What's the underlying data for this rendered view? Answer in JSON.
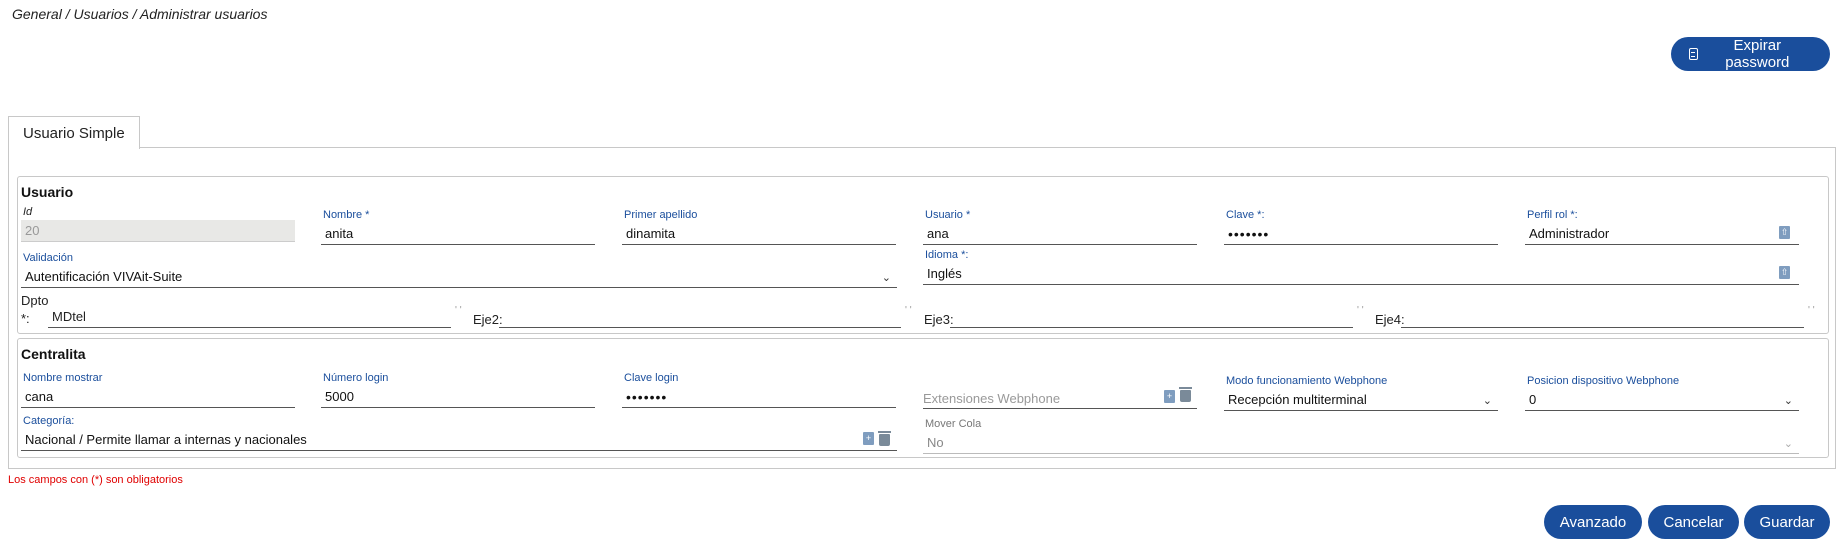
{
  "breadcrumb": "General / Usuarios / Administrar usuarios",
  "buttons": {
    "expire": "Expirar password",
    "advanced": "Avanzado",
    "cancel": "Cancelar",
    "save": "Guardar"
  },
  "tab": "Usuario Simple",
  "usuario": {
    "title": "Usuario",
    "id": {
      "label": "Id",
      "value": "20"
    },
    "nombre": {
      "label": "Nombre *",
      "value": "anita"
    },
    "apellido": {
      "label": "Primer apellido",
      "value": "dinamita"
    },
    "usuario": {
      "label": "Usuario *",
      "value": "ana"
    },
    "clave": {
      "label": "Clave *:",
      "value": "•••••••"
    },
    "perfil": {
      "label": "Perfil rol *:",
      "value": "Administrador"
    },
    "validacion": {
      "label": "Validación",
      "value": "Autentificación VIVAit-Suite"
    },
    "idioma": {
      "label": "Idioma *:",
      "value": "Inglés"
    },
    "dpto": {
      "label_top": "Dpto",
      "label_bottom": "*:",
      "value": "MDtel"
    },
    "eje2": {
      "label": "Eje2:",
      "value": ""
    },
    "eje3": {
      "label": "Eje3:",
      "value": ""
    },
    "eje4": {
      "label": "Eje4:",
      "value": ""
    }
  },
  "centralita": {
    "title": "Centralita",
    "nombre_mostrar": {
      "label": "Nombre mostrar",
      "value": "cana"
    },
    "numero_login": {
      "label": "Número login",
      "value": "5000"
    },
    "clave_login": {
      "label": "Clave login",
      "value": "•••••••"
    },
    "extensiones": {
      "placeholder": "Extensiones Webphone"
    },
    "modo": {
      "label": "Modo funcionamiento Webphone",
      "value": "Recepción multiterminal"
    },
    "posicion": {
      "label": "Posicion dispositivo Webphone",
      "value": "0"
    },
    "categoria": {
      "label": "Categoría:",
      "value": "Nacional / Permite llamar a internas y nacionales"
    },
    "mover_cola": {
      "label": "Mover Cola",
      "value": "No"
    }
  },
  "required_note": "Los campos con (*) son obligatorios",
  "colors": {
    "primary": "#1a4e9c",
    "label": "#1a4e9c",
    "required": "#e00000"
  }
}
